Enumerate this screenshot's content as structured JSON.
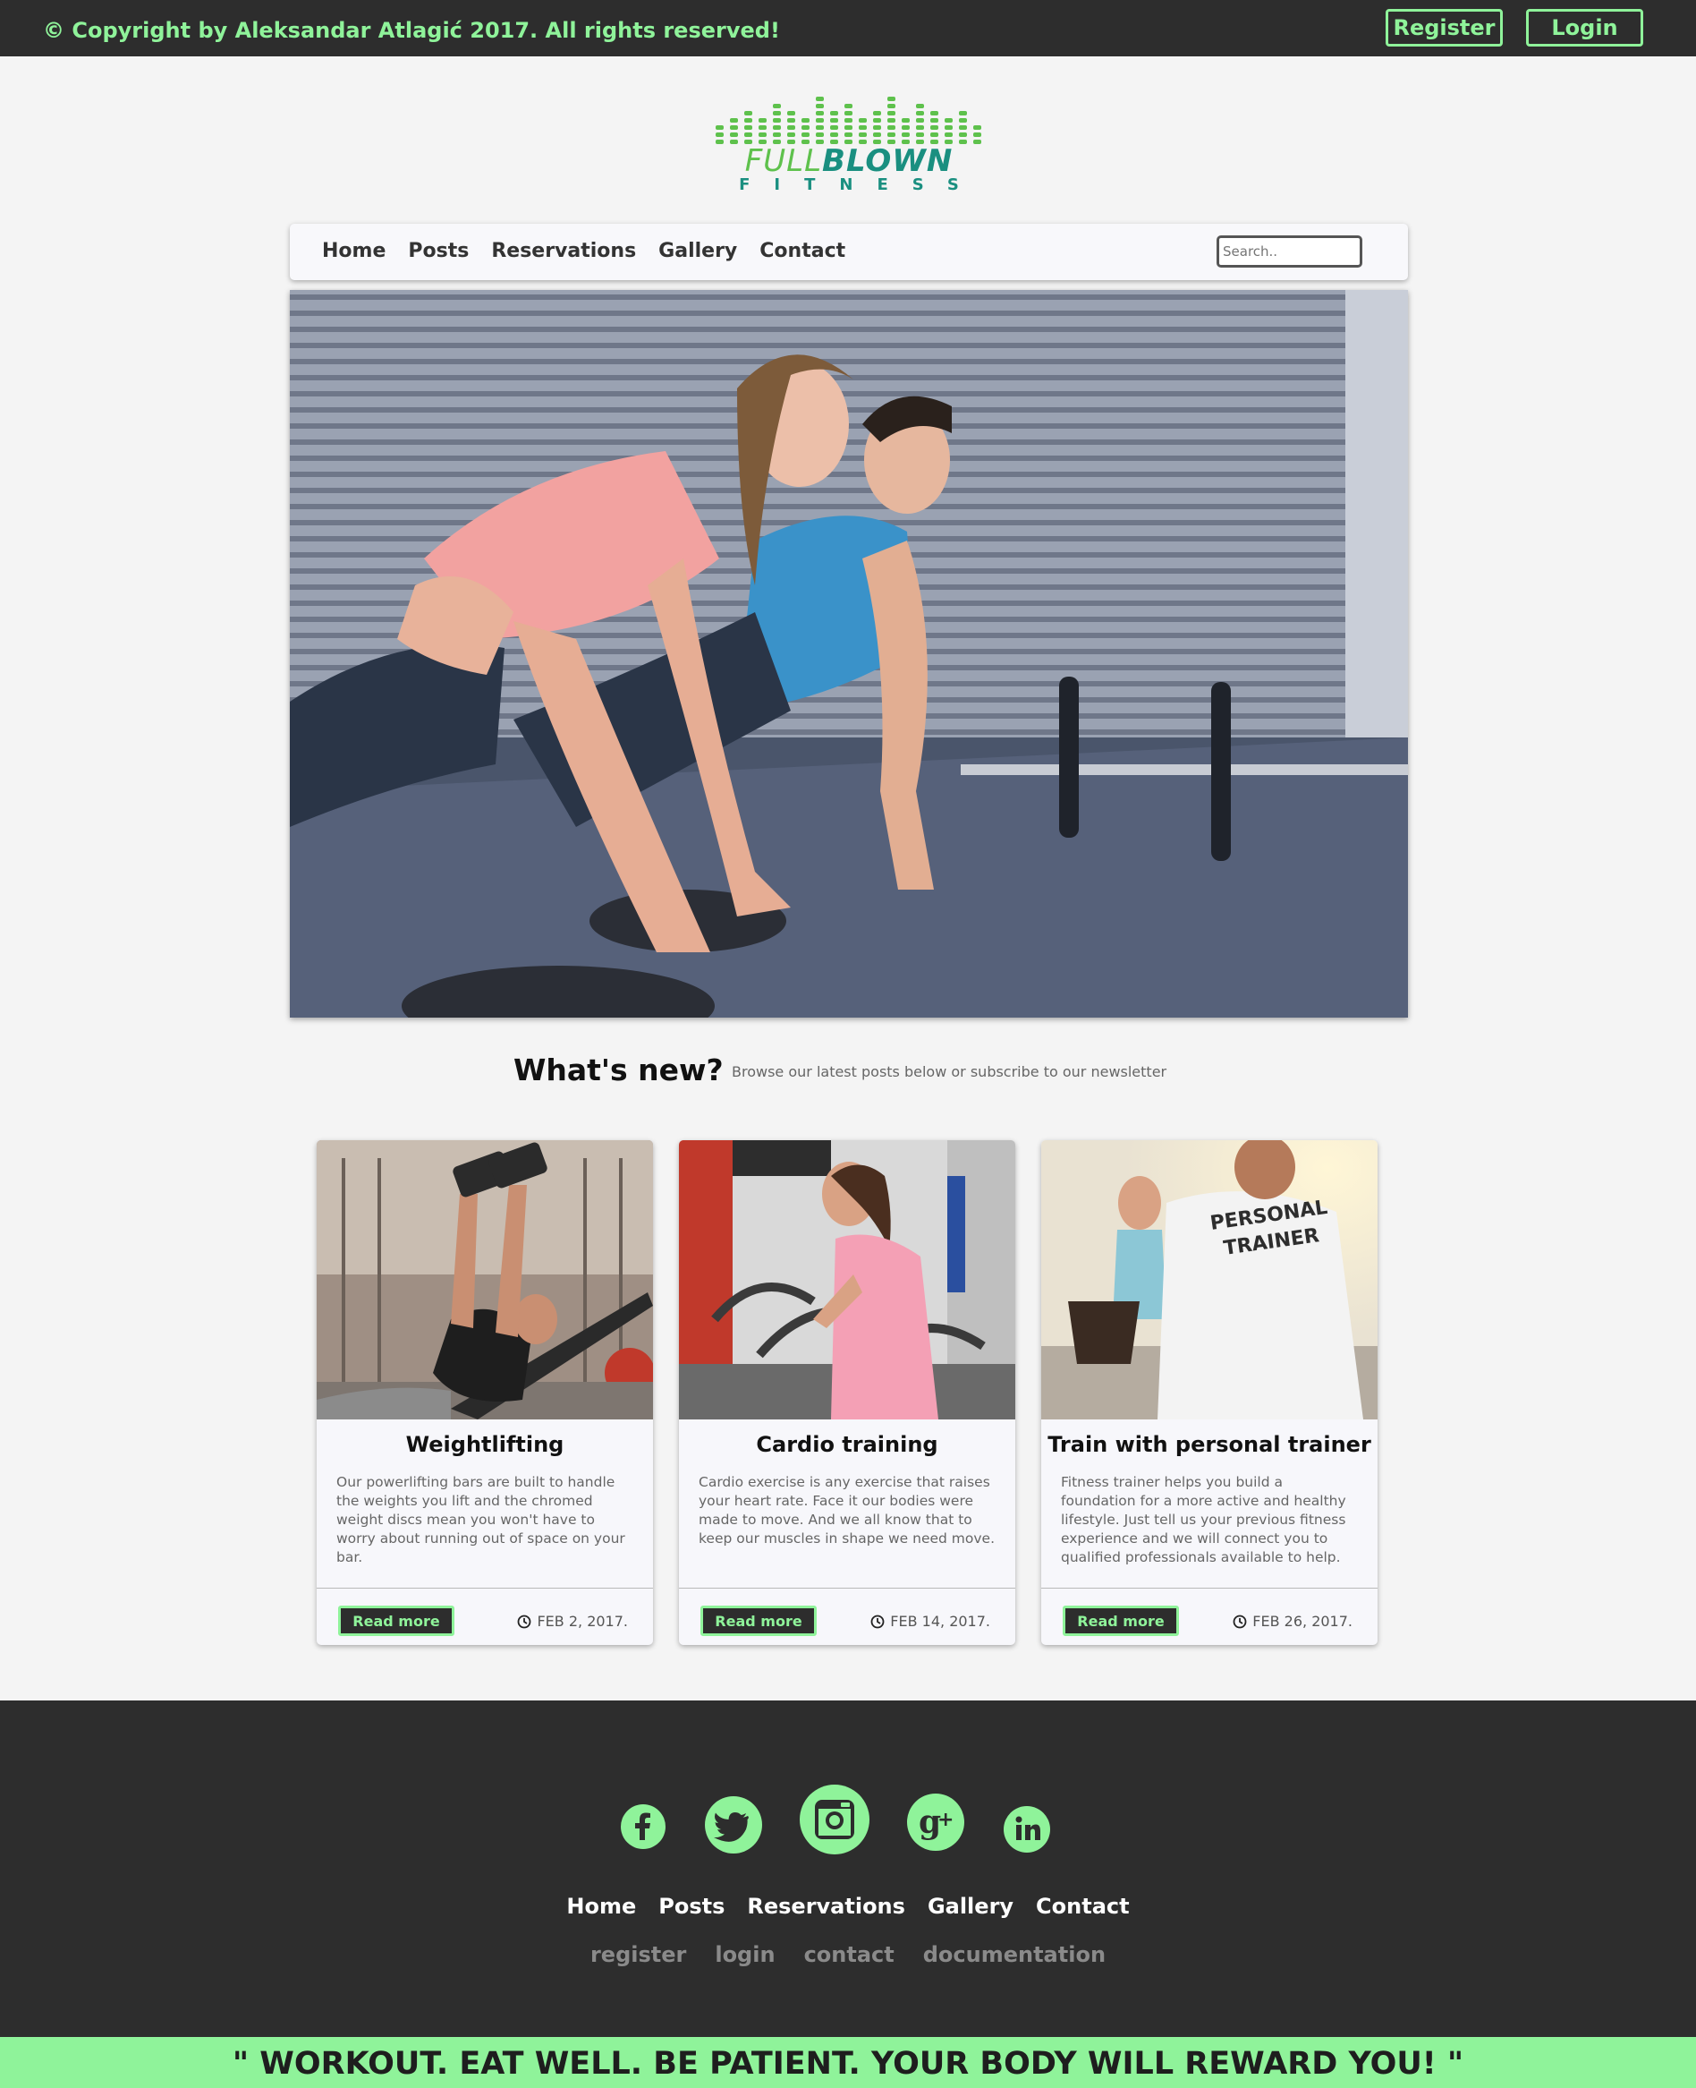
{
  "topbar": {
    "copyright": "© Copyright by Aleksandar Atlagić 2017. All rights reserved!",
    "register_label": "Register",
    "login_label": "Login"
  },
  "logo": {
    "word_part1": "FULL",
    "word_part2": "BLOWN",
    "subtitle": "FITNESS"
  },
  "nav": {
    "items": [
      "Home",
      "Posts",
      "Reservations",
      "Gallery",
      "Contact"
    ],
    "search_placeholder": "Search.."
  },
  "whats_new": {
    "title": "What's new?",
    "subtitle": "Browse our latest posts below or subscribe to our newsletter"
  },
  "cards": [
    {
      "title": "Weightlifting",
      "text": "Our powerlifting bars are built to handle the weights you lift and the chromed weight discs mean you won't have to worry about running out of space on your bar.",
      "button": "Read more",
      "date": "FEB 2, 2017."
    },
    {
      "title": "Cardio training",
      "text": "Cardio exercise is any exercise that raises your heart rate. Face it our bodies were made to move. And we all know that to keep our muscles in shape we need move.",
      "button": "Read more",
      "date": "FEB 14, 2017."
    },
    {
      "title": "Train with personal trainer",
      "text": "Fitness trainer helps you build a foundation for a more active and healthy lifestyle. Just tell us your previous fitness experience and we will connect you to qualified professionals available to help.",
      "button": "Read more",
      "date": "FEB 26, 2017.",
      "shirt_line1": "PERSONAL",
      "shirt_line2": "TRAINER"
    }
  ],
  "footer": {
    "social": [
      "facebook-icon",
      "twitter-icon",
      "instagram-icon",
      "google-plus-icon",
      "linkedin-icon"
    ],
    "nav_items": [
      "Home",
      "Posts",
      "Reservations",
      "Gallery",
      "Contact"
    ],
    "links": [
      "register",
      "login",
      "contact",
      "documentation"
    ]
  },
  "quote": "\" WORKOUT. EAT WELL. BE PATIENT. YOUR BODY WILL REWARD YOU! \"",
  "colors": {
    "accent": "#8ff39a",
    "dark": "#2d2d2d",
    "background": "#f4f4f4",
    "logo_green": "#5ec14c",
    "logo_teal": "#1a8f80"
  }
}
